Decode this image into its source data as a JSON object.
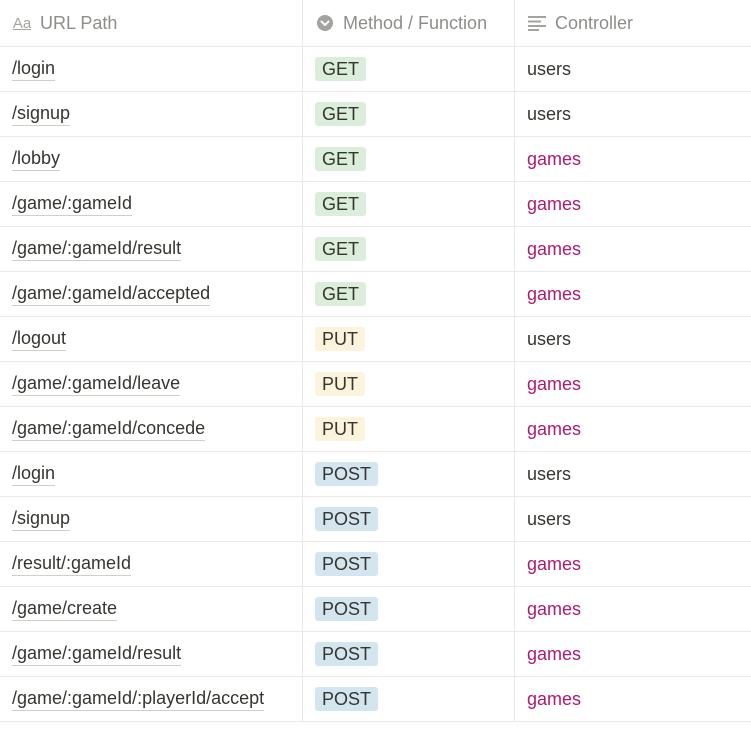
{
  "header": {
    "col_path": "URL Path",
    "col_method": "Method / Function",
    "col_controller": "Controller",
    "icon_path": "Aa"
  },
  "colors": {
    "GET": "#dbeddb",
    "PUT": "#fbf3db",
    "POST": "#d3e5ef",
    "users": "#37352f",
    "games": "#ad1a72"
  },
  "rows": [
    {
      "path": "/login",
      "method": "GET",
      "controller": "users"
    },
    {
      "path": "/signup",
      "method": "GET",
      "controller": "users"
    },
    {
      "path": "/lobby",
      "method": "GET",
      "controller": "games"
    },
    {
      "path": "/game/:gameId",
      "method": "GET",
      "controller": "games"
    },
    {
      "path": "/game/:gameId/result",
      "method": "GET",
      "controller": "games"
    },
    {
      "path": "/game/:gameId/accepted",
      "method": "GET",
      "controller": "games"
    },
    {
      "path": "/logout",
      "method": "PUT",
      "controller": "users"
    },
    {
      "path": "/game/:gameId/leave",
      "method": "PUT",
      "controller": "games"
    },
    {
      "path": "/game/:gameId/concede",
      "method": "PUT",
      "controller": "games"
    },
    {
      "path": "/login",
      "method": "POST",
      "controller": "users"
    },
    {
      "path": "/signup",
      "method": "POST",
      "controller": "users"
    },
    {
      "path": "/result/:gameId",
      "method": "POST",
      "controller": "games"
    },
    {
      "path": "/game/create",
      "method": "POST",
      "controller": "games"
    },
    {
      "path": "/game/:gameId/result",
      "method": "POST",
      "controller": "games"
    },
    {
      "path": "/game/:gameId/:playerId/accept",
      "method": "POST",
      "controller": "games"
    }
  ]
}
